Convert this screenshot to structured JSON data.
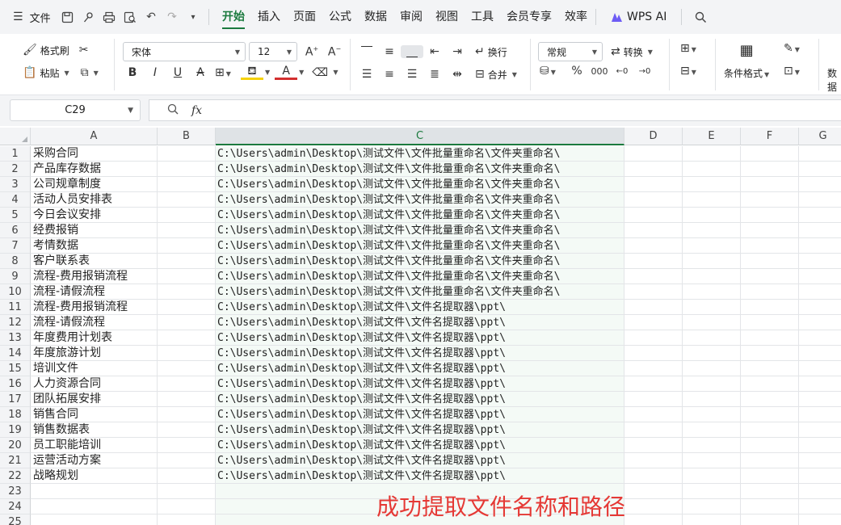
{
  "menubar": {
    "file_label": "文件",
    "tabs": [
      "开始",
      "插入",
      "页面",
      "公式",
      "数据",
      "审阅",
      "视图",
      "工具",
      "会员专享",
      "效率"
    ],
    "active_tab": "开始",
    "wps_ai_label": "WPS AI"
  },
  "ribbon": {
    "format_painter": "格式刷",
    "paste": "粘贴",
    "font_name": "宋体",
    "font_size": "12",
    "wrap": "换行",
    "merge": "合并",
    "number_format": "常规",
    "convert": "转换",
    "conditional_format": "条件格式",
    "data_partial": "数据"
  },
  "formula_bar": {
    "name_box": "C29",
    "fx_label": "fx",
    "formula": ""
  },
  "columns": [
    "A",
    "B",
    "C",
    "D",
    "E",
    "F",
    "G"
  ],
  "selected_column": "C",
  "rows": [
    {
      "n": "1",
      "a": "采购合同",
      "c": "C:\\Users\\admin\\Desktop\\测试文件\\文件批量重命名\\文件夹重命名\\"
    },
    {
      "n": "2",
      "a": "产品库存数据",
      "c": "C:\\Users\\admin\\Desktop\\测试文件\\文件批量重命名\\文件夹重命名\\"
    },
    {
      "n": "3",
      "a": "公司规章制度",
      "c": "C:\\Users\\admin\\Desktop\\测试文件\\文件批量重命名\\文件夹重命名\\"
    },
    {
      "n": "4",
      "a": "活动人员安排表",
      "c": "C:\\Users\\admin\\Desktop\\测试文件\\文件批量重命名\\文件夹重命名\\"
    },
    {
      "n": "5",
      "a": "今日会议安排",
      "c": "C:\\Users\\admin\\Desktop\\测试文件\\文件批量重命名\\文件夹重命名\\"
    },
    {
      "n": "6",
      "a": "经费报销",
      "c": "C:\\Users\\admin\\Desktop\\测试文件\\文件批量重命名\\文件夹重命名\\"
    },
    {
      "n": "7",
      "a": "考情数据",
      "c": "C:\\Users\\admin\\Desktop\\测试文件\\文件批量重命名\\文件夹重命名\\"
    },
    {
      "n": "8",
      "a": "客户联系表",
      "c": "C:\\Users\\admin\\Desktop\\测试文件\\文件批量重命名\\文件夹重命名\\"
    },
    {
      "n": "9",
      "a": "流程-费用报销流程",
      "c": "C:\\Users\\admin\\Desktop\\测试文件\\文件批量重命名\\文件夹重命名\\"
    },
    {
      "n": "10",
      "a": "流程-请假流程",
      "c": "C:\\Users\\admin\\Desktop\\测试文件\\文件批量重命名\\文件夹重命名\\"
    },
    {
      "n": "11",
      "a": "流程-费用报销流程",
      "c": "C:\\Users\\admin\\Desktop\\测试文件\\文件名提取器\\ppt\\"
    },
    {
      "n": "12",
      "a": "流程-请假流程",
      "c": "C:\\Users\\admin\\Desktop\\测试文件\\文件名提取器\\ppt\\"
    },
    {
      "n": "13",
      "a": "年度费用计划表",
      "c": "C:\\Users\\admin\\Desktop\\测试文件\\文件名提取器\\ppt\\"
    },
    {
      "n": "14",
      "a": "年度旅游计划",
      "c": "C:\\Users\\admin\\Desktop\\测试文件\\文件名提取器\\ppt\\"
    },
    {
      "n": "15",
      "a": "培训文件",
      "c": "C:\\Users\\admin\\Desktop\\测试文件\\文件名提取器\\ppt\\"
    },
    {
      "n": "16",
      "a": "人力资源合同",
      "c": "C:\\Users\\admin\\Desktop\\测试文件\\文件名提取器\\ppt\\"
    },
    {
      "n": "17",
      "a": "团队拓展安排",
      "c": "C:\\Users\\admin\\Desktop\\测试文件\\文件名提取器\\ppt\\"
    },
    {
      "n": "18",
      "a": "销售合同",
      "c": "C:\\Users\\admin\\Desktop\\测试文件\\文件名提取器\\ppt\\"
    },
    {
      "n": "19",
      "a": "销售数据表",
      "c": "C:\\Users\\admin\\Desktop\\测试文件\\文件名提取器\\ppt\\"
    },
    {
      "n": "20",
      "a": "员工职能培训",
      "c": "C:\\Users\\admin\\Desktop\\测试文件\\文件名提取器\\ppt\\"
    },
    {
      "n": "21",
      "a": "运营活动方案",
      "c": "C:\\Users\\admin\\Desktop\\测试文件\\文件名提取器\\ppt\\"
    },
    {
      "n": "22",
      "a": "战略规划",
      "c": "C:\\Users\\admin\\Desktop\\测试文件\\文件名提取器\\ppt\\"
    },
    {
      "n": "23",
      "a": "",
      "c": ""
    },
    {
      "n": "24",
      "a": "",
      "c": ""
    },
    {
      "n": "25",
      "a": "",
      "c": ""
    }
  ],
  "annotation": "成功提取文件名称和路径",
  "colors": {
    "accent": "#1b7a3e",
    "annotation": "#e53935"
  }
}
